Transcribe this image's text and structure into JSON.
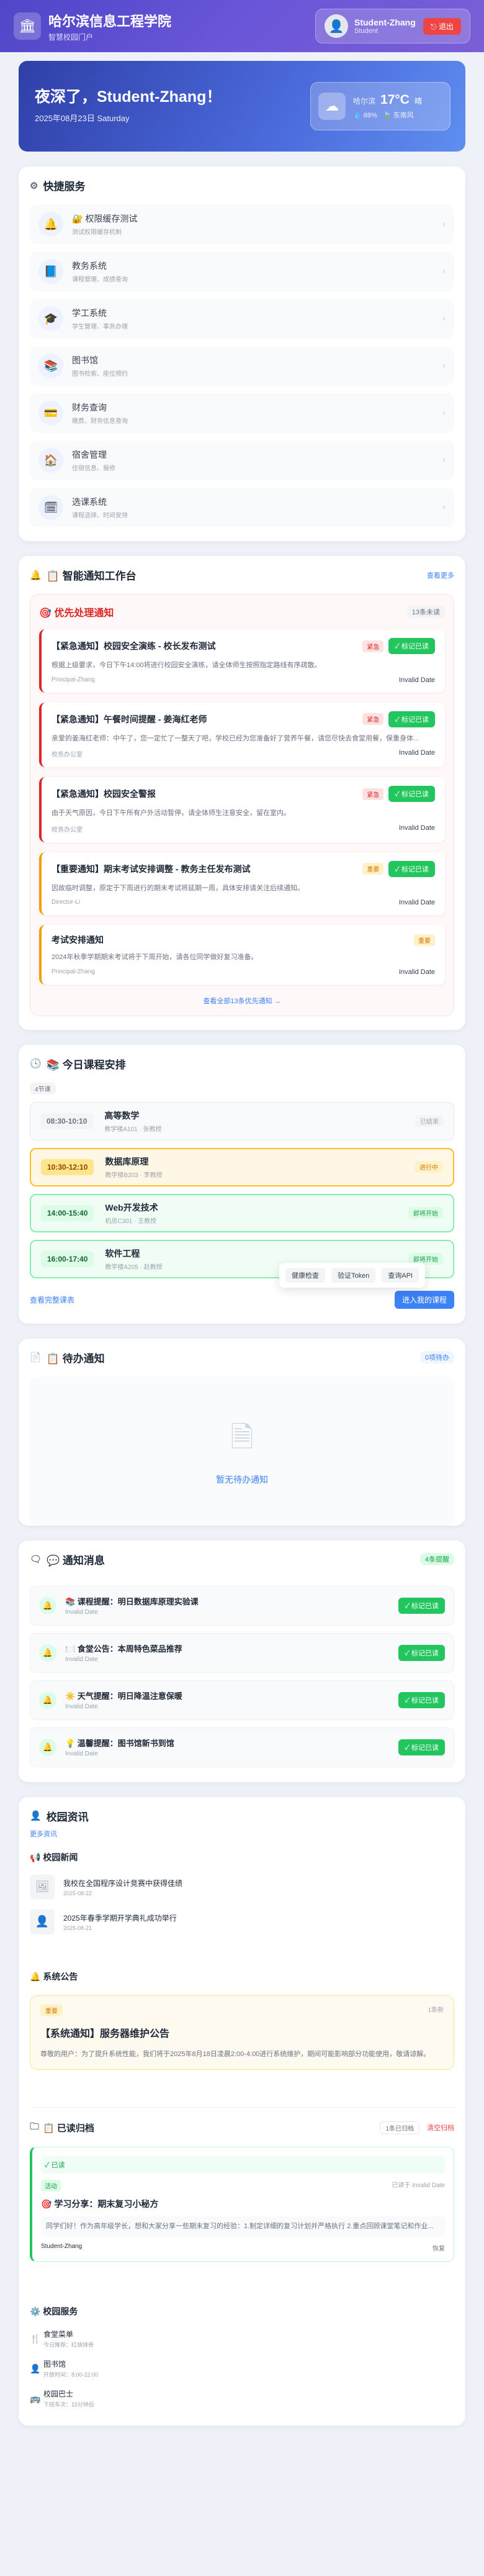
{
  "app": {
    "title": "哈尔滨信息工程学院",
    "subtitle": "智慧校园门户"
  },
  "user": {
    "name": "Student-Zhang",
    "role": "Student",
    "logout": "退出"
  },
  "hero": {
    "greeting": "夜深了，Student-Zhang！",
    "date": "2025年08月23日 Saturday"
  },
  "weather": {
    "city": "哈尔滨",
    "temp": "17°C",
    "cond": "晴",
    "humidity": "88%",
    "wind": "东南风"
  },
  "quick": {
    "title": "快捷服务",
    "items": [
      {
        "label": "🔐 权限缓存测试",
        "desc": "测试权限缓存机制"
      },
      {
        "label": "教务系统",
        "desc": "课程管理、成绩查询"
      },
      {
        "label": "学工系统",
        "desc": "学生管理、事务办理"
      },
      {
        "label": "图书馆",
        "desc": "图书检索、座位预约"
      },
      {
        "label": "财务查询",
        "desc": "缴费、财务信息查询"
      },
      {
        "label": "宿舍管理",
        "desc": "住宿信息、报修"
      },
      {
        "label": "选课系统",
        "desc": "课程选择、时间安排"
      }
    ]
  },
  "workbench": {
    "title": "📋 智能通知工作台",
    "more": "查看更多"
  },
  "priority": {
    "title": "🎯 优先处理通知",
    "count": "13条未读",
    "view_all": "查看全部13条优先通知 →",
    "notices": [
      {
        "title": "【紧急通知】校园安全演练 - 校长发布测试",
        "tag": "紧急",
        "mark": "✓ 标记已读",
        "body": "根据上级要求，今日下午14:00将进行校园安全演练，请全体师生按照指定路线有序疏散。",
        "from": "Principal-Zhang",
        "date": "Invalid Date"
      },
      {
        "title": "【紧急通知】午餐时间提醒 - 姜海红老师",
        "tag": "紧急",
        "mark": "✓ 标记已读",
        "body": "亲爱的姜海红老师：中午了，您一定忙了一整天了吧，学校已经为您准备好了营养午餐，请您尽快去食堂用餐，保重身体...",
        "from": "校务办公室",
        "date": "Invalid Date"
      },
      {
        "title": "【紧急通知】校园安全警报",
        "tag": "紧急",
        "mark": "✓ 标记已读",
        "body": "由于天气原因，今日下午所有户外活动暂停，请全体师生注意安全，留在室内。",
        "from": "校务办公室",
        "date": "Invalid Date"
      },
      {
        "title": "【重要通知】期末考试安排调整 - 教务主任发布测试",
        "tag": "重要",
        "mark": "✓ 标记已读",
        "body": "因故临时调整，原定于下周进行的期末考试将延期一周，具体安排请关注后续通知。",
        "from": "Director-Li",
        "date": "Invalid Date"
      },
      {
        "title": "考试安排通知",
        "tag": "重要",
        "mark": "",
        "body": "2024年秋季学期期末考试将于下周开始，请各位同学做好复习准备。",
        "from": "Principal-Zhang",
        "date": "Invalid Date"
      }
    ]
  },
  "popup": {
    "a": "健康检查",
    "b": "验证Token",
    "c": "查询API"
  },
  "schedule": {
    "title": "📚 今日课程安排",
    "count": "4节课",
    "more": "查看完整课表",
    "btn": "进入我的课程",
    "courses": [
      {
        "time": "08:30-10:10",
        "name": "高等数学",
        "loc": "教学楼A101 · 张教授",
        "status": "已结束"
      },
      {
        "time": "10:30-12:10",
        "name": "数据库原理",
        "loc": "教学楼B203 · 李教授",
        "status": "进行中"
      },
      {
        "time": "14:00-15:40",
        "name": "Web开发技术",
        "loc": "机房C301 · 王教授",
        "status": "即将开始"
      },
      {
        "time": "16:00-17:40",
        "name": "软件工程",
        "loc": "教学楼A205 · 赵教授",
        "status": "即将开始"
      }
    ]
  },
  "todo": {
    "title": "📋 待办通知",
    "count": "0项待办",
    "empty": "暂无待办通知"
  },
  "messages": {
    "title": "💬 通知消息",
    "count": "4条提醒",
    "items": [
      {
        "text": "📚 课程提醒：明日数据库原理实验课",
        "date": "Invalid Date",
        "mark": "✓ 标记已读"
      },
      {
        "text": "🍽️ 食堂公告：本周特色菜品推荐",
        "date": "Invalid Date",
        "mark": "✓ 标记已读"
      },
      {
        "text": "☀️ 天气提醒：明日降温注意保暖",
        "date": "Invalid Date",
        "mark": "✓ 标记已读"
      },
      {
        "text": "💡 温馨提醒：图书馆新书到馆",
        "date": "Invalid Date",
        "mark": "✓ 标记已读"
      }
    ]
  },
  "campus": {
    "title": "校园资讯",
    "more": "更多资讯",
    "news_title": "📢 校园新闻",
    "news": [
      {
        "title": "我校在全国程序设计竞赛中获得佳绩",
        "date": "2025-08-22"
      },
      {
        "title": "2025年春季学期开学典礼成功举行",
        "date": "2025-08-21"
      }
    ],
    "ann_title": "🔔 系统公告",
    "ann_count": "1条新",
    "ann": {
      "tag": "重要",
      "title": "【系统通知】服务器维护公告",
      "body": "尊敬的用户：为了提升系统性能，我们将于2025年8月18日凌晨2:00-4:00进行系统维护，期间可能影响部分功能使用，敬请谅解。"
    },
    "arch_title": "📋 已读归档",
    "arch_count": "1条已归档",
    "arch_clear": "清空归档",
    "arch": {
      "status": "已读",
      "tag": "活动",
      "time": "已读于 Invalid Date",
      "title": "🎯 学习分享：期末复习小秘方",
      "body": "同学们好！作为高年级学长，想和大家分享一些期末复习的经验：1.制定详细的复习计划并严格执行 2.重点回顾课堂笔记和作业...",
      "from": "Student-Zhang",
      "action": "恢复"
    },
    "svc_title": "⚙️ 校园服务",
    "services": [
      {
        "name": "食堂菜单",
        "desc": "今日推荐：红烧排骨"
      },
      {
        "name": "图书馆",
        "desc": "开放时间：8:00-22:00"
      },
      {
        "name": "校园巴士",
        "desc": "下班车次：15分钟后"
      }
    ]
  }
}
